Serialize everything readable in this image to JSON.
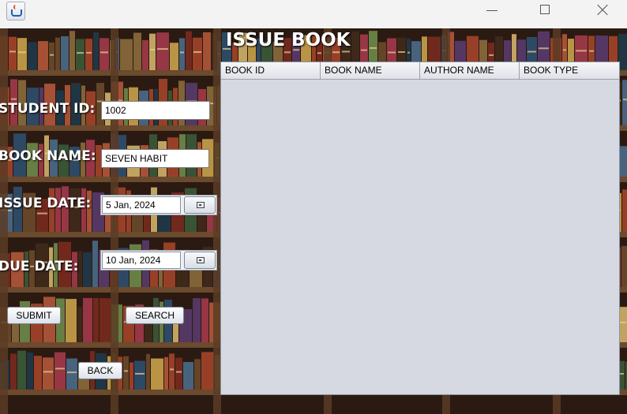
{
  "window": {
    "minimize_icon": "minimize-icon",
    "maximize_icon": "maximize-icon",
    "close_icon": "close-icon",
    "app_icon": "java-coffee-cup-icon"
  },
  "page": {
    "title": "ISSUE BOOK",
    "background": "bookshelf-image"
  },
  "form": {
    "student_id_label": "STUDENT ID:",
    "student_id_value": "1002",
    "book_name_label": "BOOK NAME:",
    "book_name_value": "SEVEN HABIT",
    "issue_date_label": "ISSUE DATE:",
    "issue_date_value": "5 Jan, 2024",
    "due_date_label": "DUE DATE:",
    "due_date_value": "10 Jan, 2024",
    "calendar_icon": "calendar-icon"
  },
  "buttons": {
    "submit": "SUBMIT",
    "search": "SEARCH",
    "back": "BACK"
  },
  "table": {
    "columns": [
      "BOOK ID",
      "BOOK NAME",
      "AUTHOR NAME",
      "BOOK TYPE"
    ],
    "rows": []
  },
  "colors": {
    "table_bg": "#d6d9e1",
    "label_text": "#ffffff"
  }
}
